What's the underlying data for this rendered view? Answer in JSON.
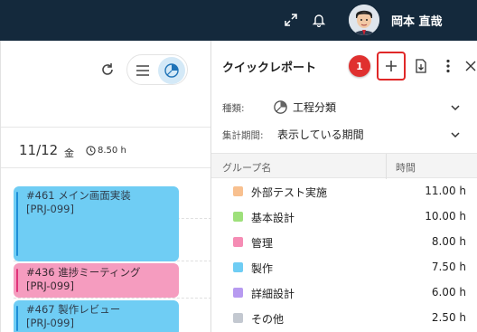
{
  "header": {
    "user_name": "岡本 直哉",
    "icons": [
      "expand-icon",
      "bell-icon",
      "avatar"
    ]
  },
  "calendar": {
    "date": "11/12",
    "weekday": "金",
    "total_hours": "8.50 h",
    "events": [
      {
        "title": "#461 メイン画面実装",
        "project": "[PRJ-099]",
        "color": "#6fcdf4"
      },
      {
        "title": "#436 進捗ミーティング",
        "project": "[PRJ-099]",
        "color": "#f59cbf"
      },
      {
        "title": "#467 製作レビュー",
        "project": "[PRJ-099]",
        "color": "#6fcdf4"
      }
    ]
  },
  "report_panel": {
    "title": "クイックレポート",
    "step_badge": "1",
    "type_label": "種類:",
    "type_value": "工程分類",
    "period_label": "集計期間:",
    "period_value": "表示している期間",
    "col_group": "グループ名",
    "col_hours": "時間",
    "rows": [
      {
        "name": "外部テスト実施",
        "hours": "11.00 h",
        "color": "#f8c08f"
      },
      {
        "name": "基本設計",
        "hours": "10.00 h",
        "color": "#9ee07b"
      },
      {
        "name": "管理",
        "hours": "8.00 h",
        "color": "#f58cb4"
      },
      {
        "name": "製作",
        "hours": "7.50 h",
        "color": "#6fcdf4"
      },
      {
        "name": "詳細設計",
        "hours": "6.00 h",
        "color": "#b79af0"
      },
      {
        "name": "その他",
        "hours": "2.50 h",
        "color": "#c3c8d0"
      }
    ]
  }
}
